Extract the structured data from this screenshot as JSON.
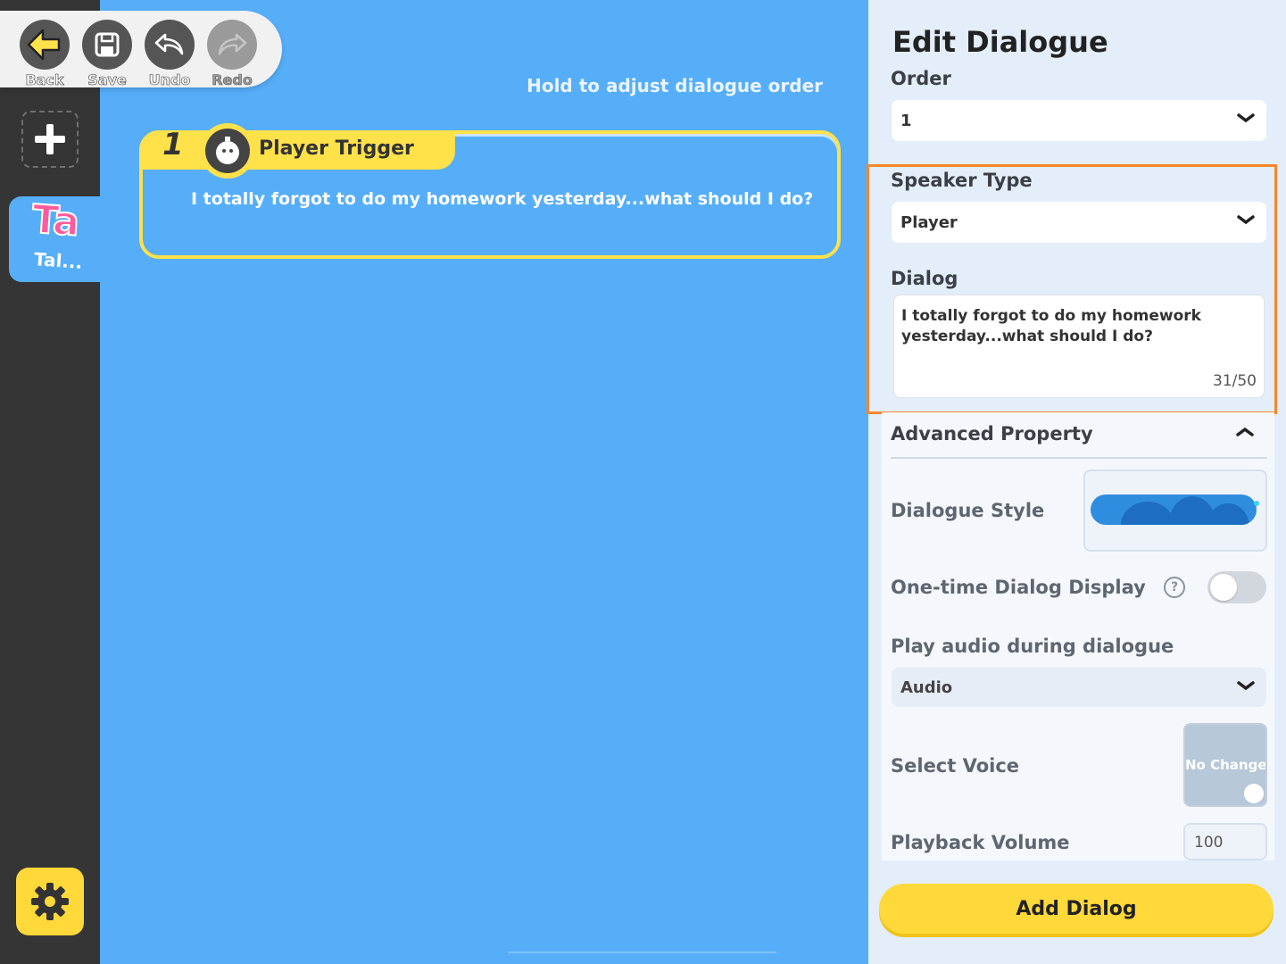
{
  "toolbar": {
    "back_label": "Back",
    "save_label": "Save",
    "undo_label": "Undo",
    "redo_label": "Redo"
  },
  "sidebar": {
    "tab_icon_text": "Ta",
    "tab_label": "Tal..."
  },
  "canvas": {
    "hint": "Hold to adjust dialogue order",
    "dialogue": {
      "number": "1",
      "title": "Player Trigger",
      "text": "I totally forgot to do my homework yesterday...what should I do?"
    }
  },
  "panel": {
    "title": "Edit Dialogue",
    "order_label": "Order",
    "order_value": "1",
    "speaker_type_label": "Speaker Type",
    "speaker_type_value": "Player",
    "dialog_label": "Dialog",
    "dialog_value": "I totally forgot to do my homework yesterday...what should I do?",
    "dialog_count": "31/50",
    "advanced_label": "Advanced Property",
    "dialogue_style_label": "Dialogue Style",
    "one_time_label": "One-time Dialog Display",
    "one_time_on": false,
    "help_glyph": "?",
    "play_audio_label": "Play audio during dialogue",
    "audio_value": "Audio",
    "select_voice_label": "Select Voice",
    "voice_value": "No Change",
    "playback_volume_label": "Playback Volume",
    "playback_volume_value": "100",
    "add_button_label": "Add Dialog"
  },
  "colors": {
    "canvas_bg": "#56aef9",
    "rail_bg": "#353535",
    "accent_yellow": "#ffd83a",
    "card_border": "#ffe14a",
    "highlight_orange": "#f6862c",
    "tab_pink": "#ff5b9c"
  }
}
